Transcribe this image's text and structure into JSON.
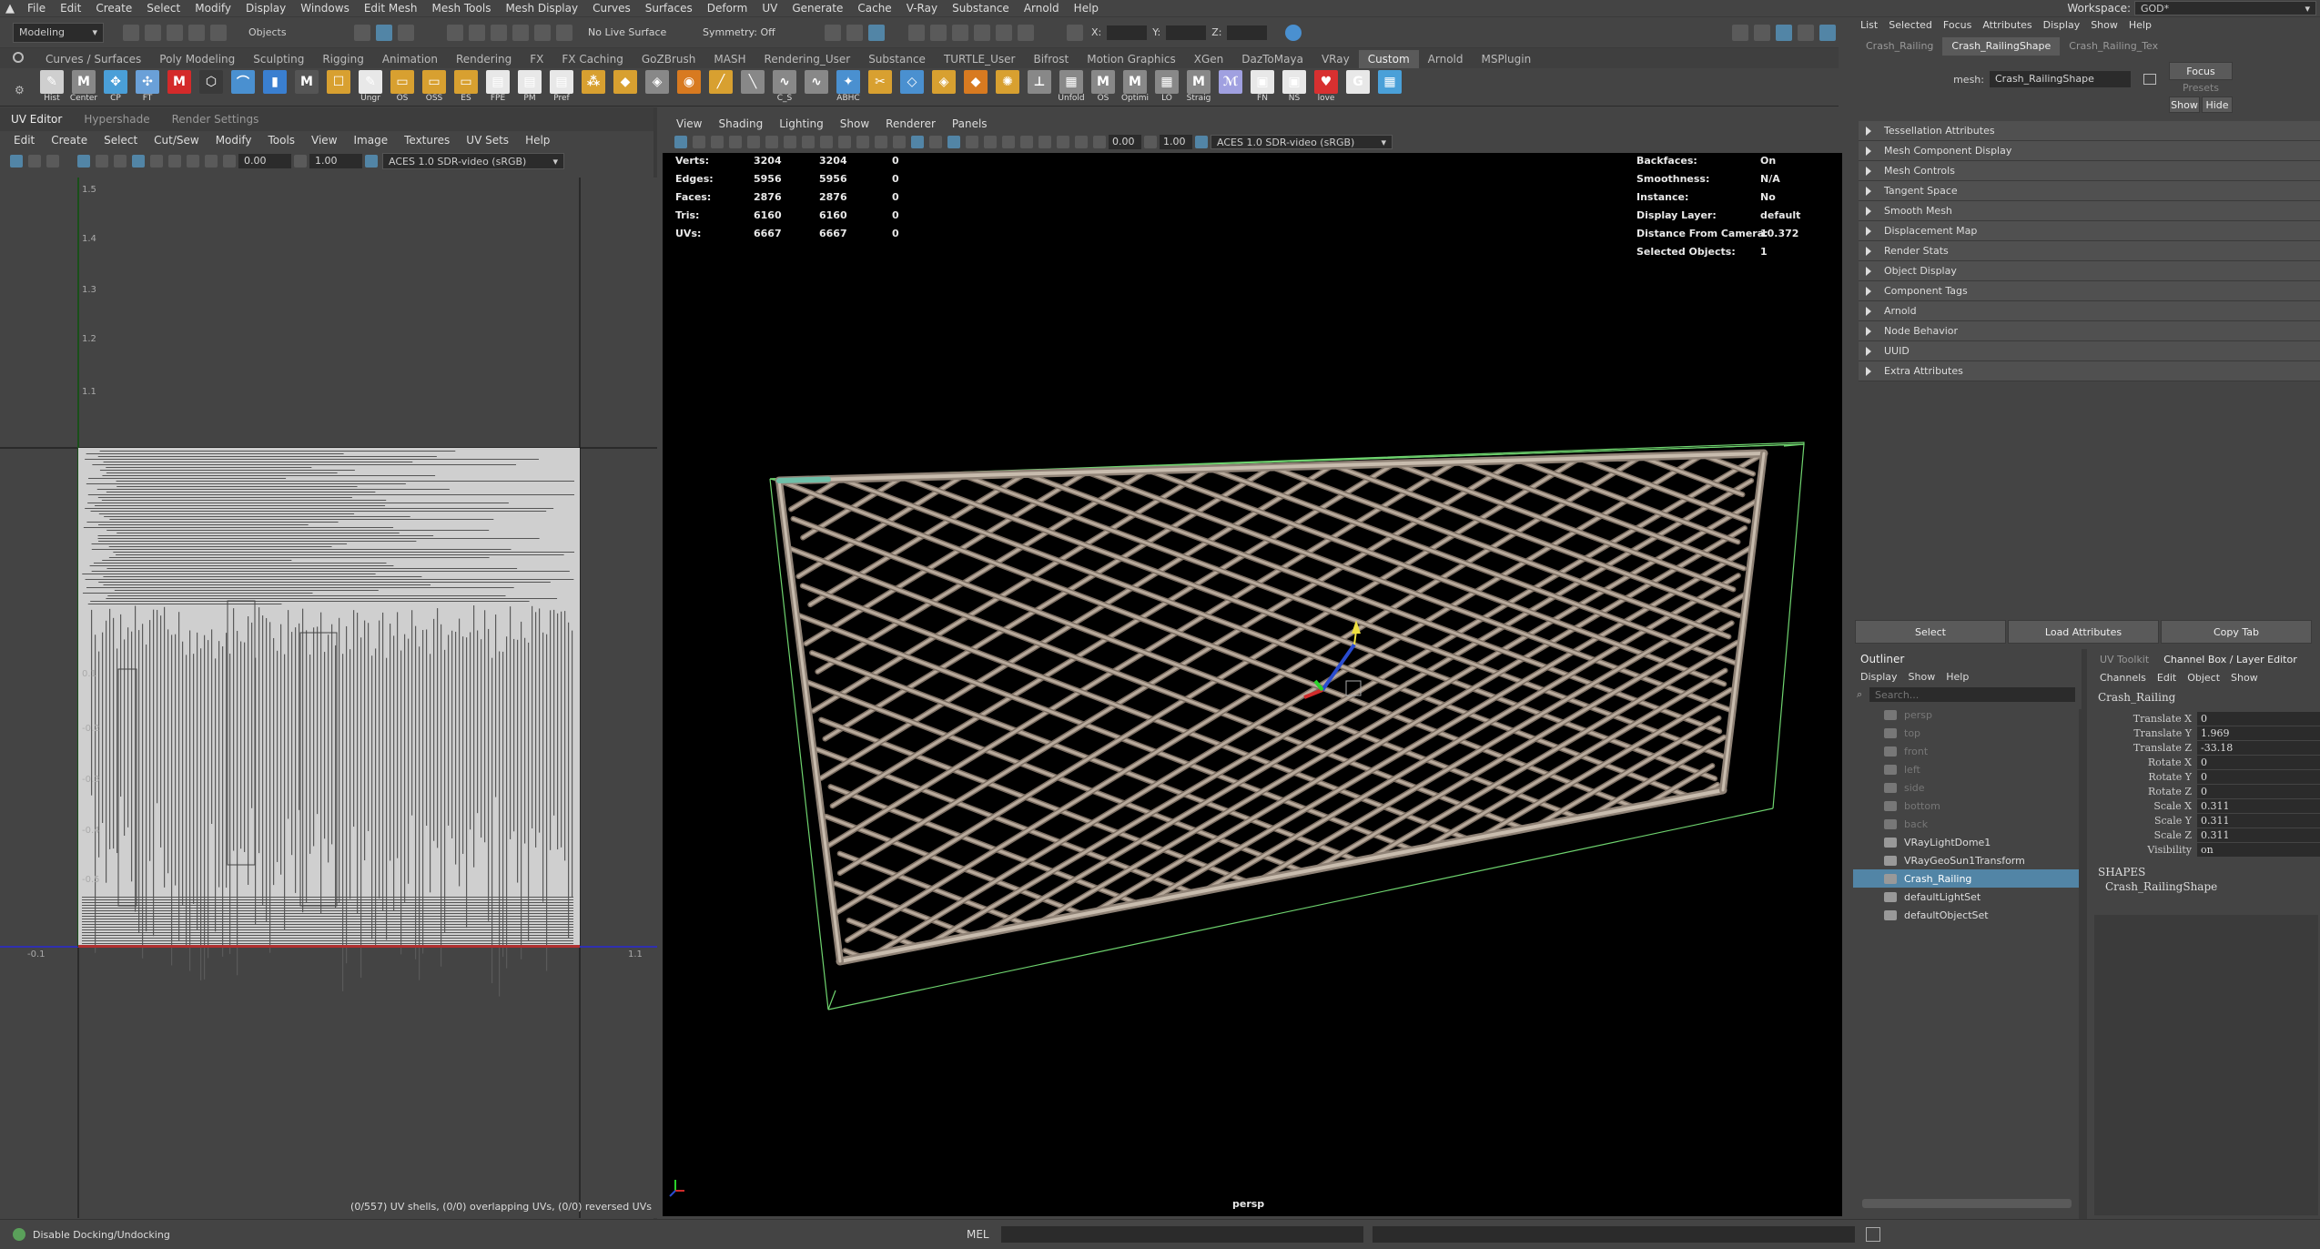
{
  "menubar": {
    "items": [
      "File",
      "Edit",
      "Create",
      "Select",
      "Modify",
      "Display",
      "Windows",
      "Edit Mesh",
      "Mesh Tools",
      "Mesh Display",
      "Curves",
      "Surfaces",
      "Deform",
      "UV",
      "Generate",
      "Cache",
      "V-Ray",
      "Substance",
      "Arnold",
      "Help"
    ],
    "workspace_label": "Workspace:",
    "workspace_value": "GOD*"
  },
  "toolbar": {
    "mode": "Modeling",
    "select_mode": "Objects",
    "live_surface": "No Live Surface",
    "symmetry": "Symmetry: Off",
    "x_label": "X:",
    "y_label": "Y:",
    "z_label": "Z:"
  },
  "shelf": {
    "tabs": [
      "Curves / Surfaces",
      "Poly Modeling",
      "Sculpting",
      "Rigging",
      "Animation",
      "Rendering",
      "FX",
      "FX Caching",
      "GoZBrush",
      "MASH",
      "Rendering_User",
      "Substance",
      "TURTLE_User",
      "Bifrost",
      "Motion Graphics",
      "XGen",
      "DazToMaya",
      "VRay",
      "Custom",
      "Arnold",
      "MSPlugin"
    ],
    "active_tab": "Custom",
    "icons": [
      {
        "label": "Hist",
        "color": "#cfcfcf",
        "glyph": "✎"
      },
      {
        "label": "Center",
        "color": "#888888",
        "glyph": "M"
      },
      {
        "label": "CP",
        "color": "#4a9fd8",
        "glyph": "✥"
      },
      {
        "label": "FT",
        "color": "#6aa0d8",
        "glyph": "✣"
      },
      {
        "label": "",
        "color": "#d42a2a",
        "glyph": "M"
      },
      {
        "label": "",
        "color": "#3a3a3a",
        "glyph": "⬡"
      },
      {
        "label": "",
        "color": "#4a90d0",
        "glyph": "⌒"
      },
      {
        "label": "",
        "color": "#3a7fd0",
        "glyph": "▮"
      },
      {
        "label": "",
        "color": "#555555",
        "glyph": "M"
      },
      {
        "label": "",
        "color": "#d8a030",
        "glyph": "☐"
      },
      {
        "label": "Ungr",
        "color": "#e8e8e8",
        "glyph": "✎"
      },
      {
        "label": "OS",
        "color": "#d8a030",
        "glyph": "▭"
      },
      {
        "label": "OSS",
        "color": "#d8a030",
        "glyph": "▭"
      },
      {
        "label": "ES",
        "color": "#d8a030",
        "glyph": "▭"
      },
      {
        "label": "FPE",
        "color": "#e8e8e8",
        "glyph": "▤"
      },
      {
        "label": "PM",
        "color": "#e8e8e8",
        "glyph": "▤"
      },
      {
        "label": "Pref",
        "color": "#e8e8e8",
        "glyph": "▤"
      },
      {
        "label": "",
        "color": "#d8a030",
        "glyph": "⁂"
      },
      {
        "label": "",
        "color": "#d8a030",
        "glyph": "◆"
      },
      {
        "label": "",
        "color": "#888888",
        "glyph": "◈"
      },
      {
        "label": "",
        "color": "#d87a20",
        "glyph": "◉"
      },
      {
        "label": "",
        "color": "#d8a030",
        "glyph": "╱"
      },
      {
        "label": "",
        "color": "#888888",
        "glyph": "╲"
      },
      {
        "label": "C_S",
        "color": "#888888",
        "glyph": "∿"
      },
      {
        "label": "",
        "color": "#888888",
        "glyph": "∿"
      },
      {
        "label": "ABHC",
        "color": "#4a90d0",
        "glyph": "✦"
      },
      {
        "label": "",
        "color": "#d8a030",
        "glyph": "✂"
      },
      {
        "label": "",
        "color": "#4a90d0",
        "glyph": "◇"
      },
      {
        "label": "",
        "color": "#d8a030",
        "glyph": "◈"
      },
      {
        "label": "",
        "color": "#d87a20",
        "glyph": "◆"
      },
      {
        "label": "",
        "color": "#d8a030",
        "glyph": "✺"
      },
      {
        "label": "",
        "color": "#888888",
        "glyph": "⊥"
      },
      {
        "label": "Unfold",
        "color": "#888888",
        "glyph": "▦"
      },
      {
        "label": "OS",
        "color": "#888888",
        "glyph": "M"
      },
      {
        "label": "Optimi",
        "color": "#888888",
        "glyph": "M"
      },
      {
        "label": "LO",
        "color": "#888888",
        "glyph": "▦"
      },
      {
        "label": "Straig",
        "color": "#888888",
        "glyph": "M"
      },
      {
        "label": "",
        "color": "#a0a0e0",
        "glyph": "ℳ"
      },
      {
        "label": "FN",
        "color": "#e8e8e8",
        "glyph": "▣"
      },
      {
        "label": "NS",
        "color": "#e8e8e8",
        "glyph": "▣"
      },
      {
        "label": "love",
        "color": "#d83030",
        "glyph": "♥"
      },
      {
        "label": "",
        "color": "#e8e8e8",
        "glyph": "G"
      },
      {
        "label": "",
        "color": "#4aa0d8",
        "glyph": "▦"
      }
    ]
  },
  "uv_editor": {
    "tabs": [
      "UV Editor",
      "Hypershade",
      "Render Settings"
    ],
    "menu": [
      "Edit",
      "Create",
      "Select",
      "Cut/Sew",
      "Modify",
      "Tools",
      "View",
      "Image",
      "Textures",
      "UV Sets",
      "Help"
    ],
    "val1": "0.00",
    "val2": "1.00",
    "colorspace": "ACES 1.0 SDR-video (sRGB)",
    "v_labels": [
      "1.5",
      "1.4",
      "1.3",
      "1.2",
      "1.1",
      "0.1",
      "-0.2",
      "-0.3",
      "-0.4",
      "-0.5"
    ],
    "u_labels": [
      "-0.1",
      "1.1"
    ],
    "status": "(0/557) UV shells, (0/0) overlapping UVs, (0/0) reversed UVs"
  },
  "viewport": {
    "menu": [
      "View",
      "Shading",
      "Lighting",
      "Show",
      "Renderer",
      "Panels"
    ],
    "val1": "0.00",
    "val2": "1.00",
    "colorspace": "ACES 1.0 SDR-video (sRGB)",
    "stats": [
      {
        "label": "Verts:",
        "a": "3204",
        "b": "3204",
        "c": "0"
      },
      {
        "label": "Edges:",
        "a": "5956",
        "b": "5956",
        "c": "0"
      },
      {
        "label": "Faces:",
        "a": "2876",
        "b": "2876",
        "c": "0"
      },
      {
        "label": "Tris:",
        "a": "6160",
        "b": "6160",
        "c": "0"
      },
      {
        "label": "UVs:",
        "a": "6667",
        "b": "6667",
        "c": "0"
      }
    ],
    "info": [
      {
        "label": "Backfaces:",
        "value": "On"
      },
      {
        "label": "Smoothness:",
        "value": "N/A"
      },
      {
        "label": "Instance:",
        "value": "No"
      },
      {
        "label": "Display Layer:",
        "value": "default"
      },
      {
        "label": "Distance From Camera:",
        "value": "10.372"
      },
      {
        "label": "Selected Objects:",
        "value": "1"
      }
    ],
    "camera": "persp"
  },
  "attribute_editor": {
    "menu": [
      "List",
      "Selected",
      "Focus",
      "Attributes",
      "Display",
      "Show",
      "Help"
    ],
    "tabs": [
      "Crash_Railing",
      "Crash_RailingShape",
      "Crash_Railing_Tex"
    ],
    "active_tab": "Crash_RailingShape",
    "mesh_label": "mesh:",
    "mesh_value": "Crash_RailingShape",
    "focus": "Focus",
    "presets": "Presets",
    "show": "Show",
    "hide": "Hide",
    "sections": [
      "Tessellation Attributes",
      "Mesh Component Display",
      "Mesh Controls",
      "Tangent Space",
      "Smooth Mesh",
      "Displacement Map",
      "Render Stats",
      "Object Display",
      "Component Tags",
      "Arnold",
      "Node Behavior",
      "UUID",
      "Extra Attributes"
    ],
    "buttons": [
      "Select",
      "Load Attributes",
      "Copy Tab"
    ]
  },
  "outliner": {
    "title": "Outliner",
    "menu": [
      "Display",
      "Show",
      "Help"
    ],
    "search_placeholder": "Search...",
    "items": [
      {
        "name": "persp",
        "dim": true,
        "sel": false
      },
      {
        "name": "top",
        "dim": true,
        "sel": false
      },
      {
        "name": "front",
        "dim": true,
        "sel": false
      },
      {
        "name": "left",
        "dim": true,
        "sel": false
      },
      {
        "name": "side",
        "dim": true,
        "sel": false
      },
      {
        "name": "bottom",
        "dim": true,
        "sel": false
      },
      {
        "name": "back",
        "dim": true,
        "sel": false
      },
      {
        "name": "VRayLightDome1",
        "dim": false,
        "sel": false
      },
      {
        "name": "VRayGeoSun1Transform",
        "dim": false,
        "sel": false
      },
      {
        "name": "Crash_Railing",
        "dim": false,
        "sel": true
      },
      {
        "name": "defaultLightSet",
        "dim": false,
        "sel": false
      },
      {
        "name": "defaultObjectSet",
        "dim": false,
        "sel": false
      }
    ]
  },
  "channel_box": {
    "tabs": [
      "UV Toolkit",
      "Channel Box / Layer Editor"
    ],
    "menu": [
      "Channels",
      "Edit",
      "Object",
      "Show"
    ],
    "object": "Crash_Railing",
    "channels": [
      {
        "name": "Translate X",
        "value": "0"
      },
      {
        "name": "Translate Y",
        "value": "1.969"
      },
      {
        "name": "Translate Z",
        "value": "-33.18"
      },
      {
        "name": "Rotate X",
        "value": "0"
      },
      {
        "name": "Rotate Y",
        "value": "0"
      },
      {
        "name": "Rotate Z",
        "value": "0"
      },
      {
        "name": "Scale X",
        "value": "0.311"
      },
      {
        "name": "Scale Y",
        "value": "0.311"
      },
      {
        "name": "Scale Z",
        "value": "0.311"
      },
      {
        "name": "Visibility",
        "value": "on"
      }
    ],
    "shapes_label": "SHAPES",
    "shape": "Crash_RailingShape"
  },
  "statusbar": {
    "help": "Disable Docking/Undocking",
    "mel": "MEL"
  }
}
